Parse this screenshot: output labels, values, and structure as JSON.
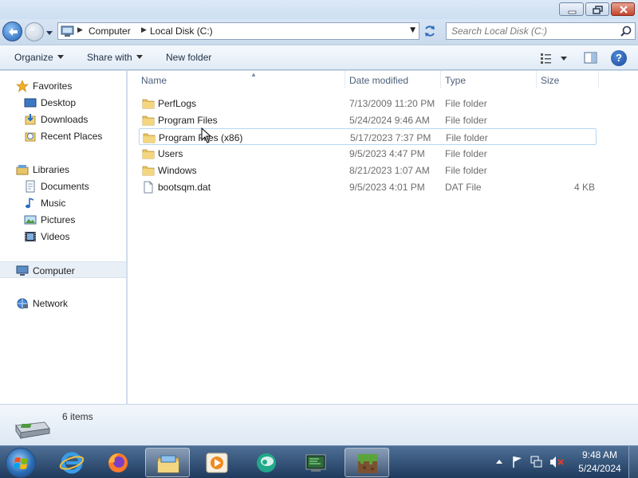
{
  "window": {
    "controls": {
      "minimize": "minimize-icon",
      "maximize": "restore-icon",
      "close": "close-icon"
    }
  },
  "navigation": {
    "address_segments": [
      "Computer",
      "Local Disk (C:)"
    ],
    "search_placeholder": "Search Local Disk (C:)"
  },
  "toolbar": {
    "organize_label": "Organize",
    "share_label": "Share with",
    "new_folder_label": "New folder"
  },
  "sidebar": {
    "favorites": {
      "label": "Favorites",
      "items": [
        "Desktop",
        "Downloads",
        "Recent Places"
      ]
    },
    "libraries": {
      "label": "Libraries",
      "items": [
        "Documents",
        "Music",
        "Pictures",
        "Videos"
      ]
    },
    "computer": {
      "label": "Computer",
      "selected": true
    },
    "network": {
      "label": "Network"
    }
  },
  "file_list": {
    "columns": [
      "Name",
      "Date modified",
      "Type",
      "Size"
    ],
    "rows": [
      {
        "name": "PerfLogs",
        "date": "7/13/2009 11:20 PM",
        "type": "File folder",
        "size": "",
        "icon": "folder-icon"
      },
      {
        "name": "Program Files",
        "date": "5/24/2024 9:46 AM",
        "type": "File folder",
        "size": "",
        "icon": "folder-icon"
      },
      {
        "name": "Program Files (x86)",
        "date": "5/17/2023 7:37 PM",
        "type": "File folder",
        "size": "",
        "icon": "folder-icon"
      },
      {
        "name": "Users",
        "date": "9/5/2023 4:47 PM",
        "type": "File folder",
        "size": "",
        "icon": "folder-icon"
      },
      {
        "name": "Windows",
        "date": "8/21/2023 1:07 AM",
        "type": "File folder",
        "size": "",
        "icon": "folder-icon"
      },
      {
        "name": "bootsqm.dat",
        "date": "9/5/2023 4:01 PM",
        "type": "DAT File",
        "size": "4 KB",
        "icon": "file-icon"
      }
    ]
  },
  "details": {
    "item_count": "6 items"
  },
  "taskbar": {
    "apps": [
      "internet-explorer-icon",
      "firefox-icon",
      "windows-explorer-icon",
      "media-player-icon",
      "chat-app-icon",
      "terminal-app-icon",
      "minecraft-icon"
    ],
    "clock_time": "9:48 AM",
    "clock_date": "5/24/2024"
  }
}
